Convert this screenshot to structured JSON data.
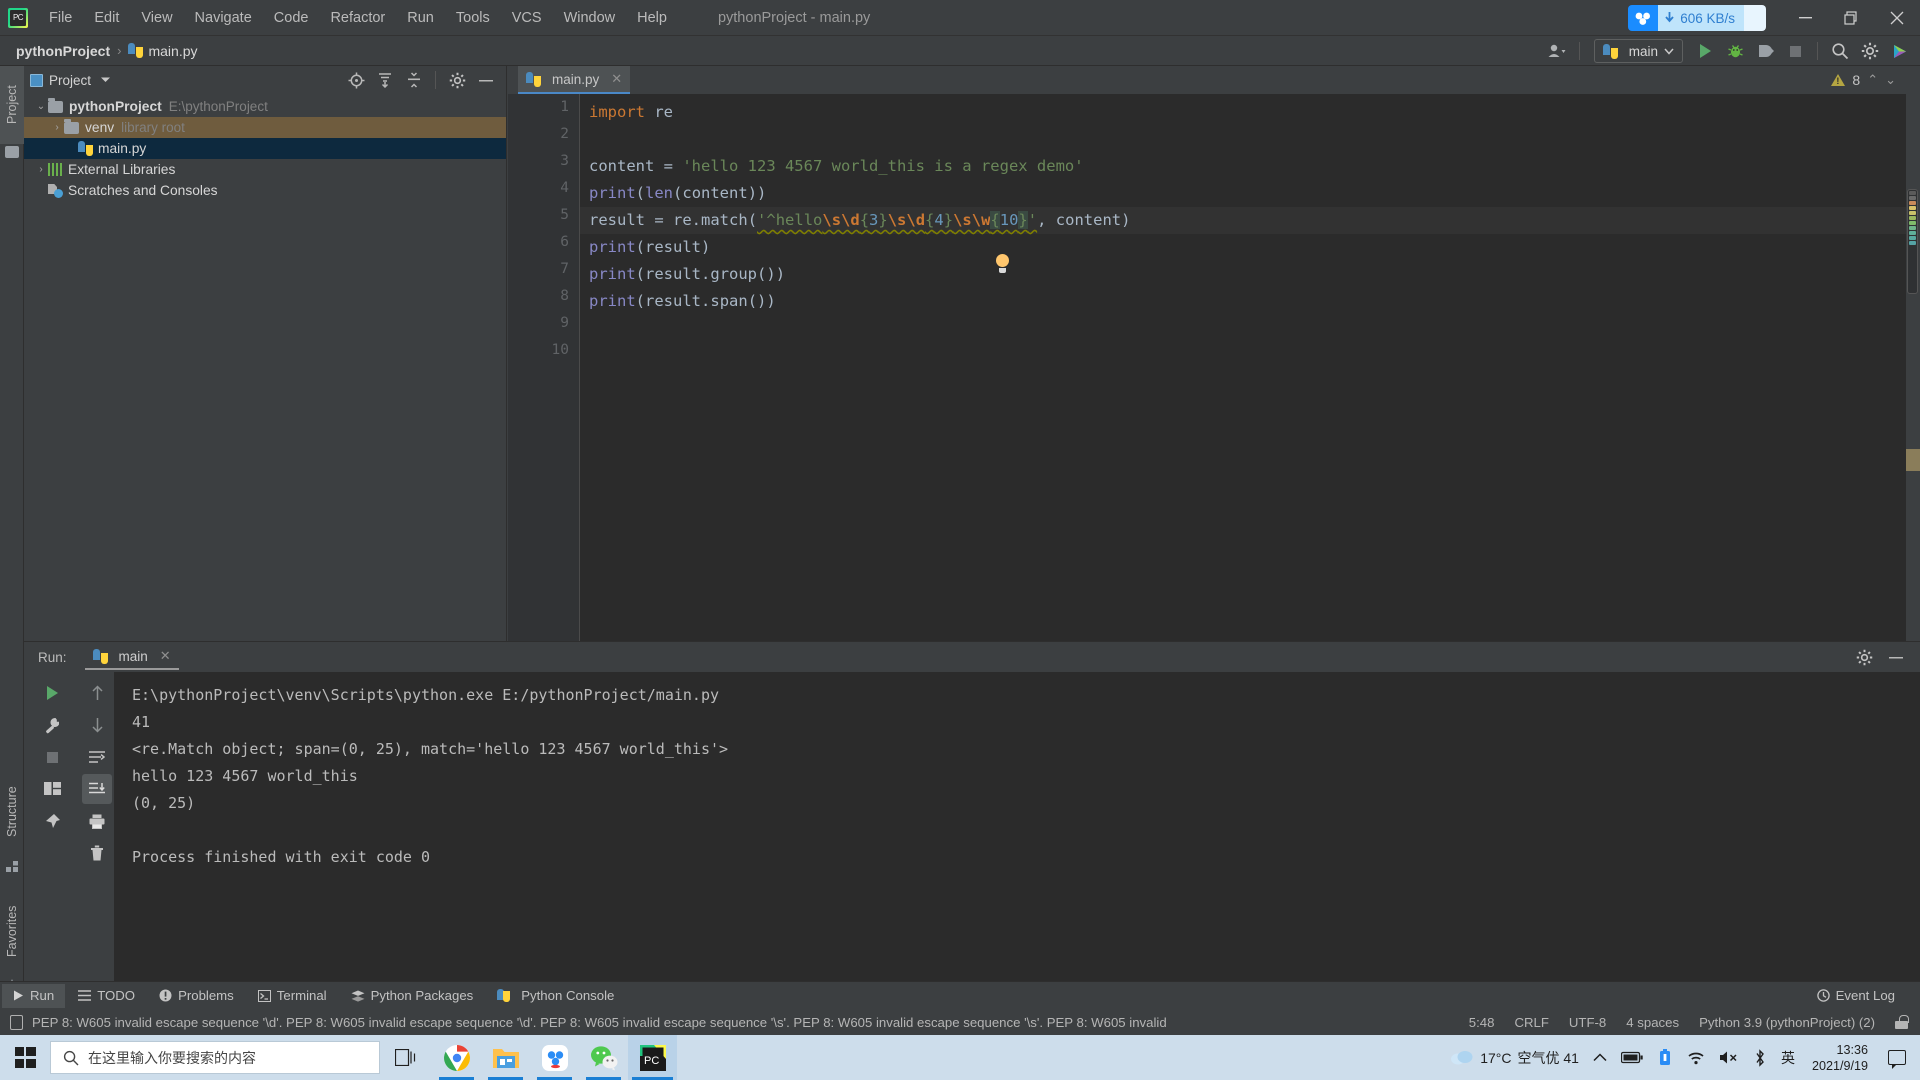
{
  "titlebar": {
    "app_icon": "pycharm-logo-icon",
    "window_title": "pythonProject - main.py",
    "net_speed": "606 KB/s",
    "net_icon": "baidu-netdisk-icon",
    "minimize": "—",
    "maximize": "❐",
    "close": "✕"
  },
  "menu": [
    {
      "label": "File"
    },
    {
      "label": "Edit"
    },
    {
      "label": "View"
    },
    {
      "label": "Navigate"
    },
    {
      "label": "Code"
    },
    {
      "label": "Refactor"
    },
    {
      "label": "Run"
    },
    {
      "label": "Tools"
    },
    {
      "label": "VCS"
    },
    {
      "label": "Window"
    },
    {
      "label": "Help"
    }
  ],
  "navbar": {
    "breadcrumb_project": "pythonProject",
    "breadcrumb_sep": "›",
    "breadcrumb_file": "main.py",
    "run_config": "main",
    "icons": {
      "user": "user-account-icon",
      "dropdown": "chevron-down-icon",
      "run": "run-icon",
      "debug": "debug-icon",
      "coverage": "run-with-coverage-icon",
      "stop": "stop-icon",
      "search": "search-everywhere-icon",
      "settings": "settings-gear-icon",
      "updates": "ide-updates-icon"
    }
  },
  "left_stripe": {
    "project": "Project",
    "structure": "Structure",
    "favorites": "Favorites"
  },
  "project_panel": {
    "title": "Project",
    "header_icons": [
      "locate-icon",
      "expand-all-icon",
      "collapse-all-icon",
      "settings-gear-icon",
      "hide-icon"
    ],
    "tree": [
      {
        "label": "pythonProject",
        "path": "E:\\pythonProject",
        "icon": "folder-icon",
        "arrow": "⌄",
        "state": "expanded",
        "bold": true
      },
      {
        "label": "venv",
        "path": "library root",
        "icon": "folder-icon",
        "arrow": "›",
        "state": "highlighted",
        "bold": false
      },
      {
        "label": "main.py",
        "path": "",
        "icon": "python-file-icon",
        "arrow": "",
        "state": "selected",
        "bold": false
      },
      {
        "label": "External Libraries",
        "path": "",
        "icon": "library-icon",
        "arrow": "›",
        "state": "normal",
        "bold": false
      },
      {
        "label": "Scratches and Consoles",
        "path": "",
        "icon": "scratches-icon",
        "arrow": "",
        "state": "normal",
        "bold": false
      }
    ]
  },
  "editor": {
    "tab_label": "main.py",
    "tab_icon": "python-file-icon",
    "tab_close": "✕",
    "warning_count": "8",
    "warning_icon": "warning-triangle-icon",
    "chevron_up": "⌃",
    "chevron_down": "⌄",
    "line_numbers": [
      "1",
      "2",
      "3",
      "4",
      "5",
      "6",
      "7",
      "8",
      "9",
      "10"
    ],
    "code_lines": [
      {
        "n": 1,
        "text": "import re"
      },
      {
        "n": 2,
        "text": ""
      },
      {
        "n": 3,
        "text": "content = 'hello 123 4567 world_this is a regex demo'"
      },
      {
        "n": 4,
        "text": "print(len(content))"
      },
      {
        "n": 5,
        "text": "result = re.match('^hello\\s\\d{3}\\s\\d{4}\\s\\w{10}', content)"
      },
      {
        "n": 6,
        "text": "print(result)"
      },
      {
        "n": 7,
        "text": "print(result.group())"
      },
      {
        "n": 8,
        "text": "print(result.span())"
      },
      {
        "n": 9,
        "text": ""
      },
      {
        "n": 10,
        "text": ""
      }
    ],
    "cursor_line": 5
  },
  "run_panel": {
    "label": "Run:",
    "tab_name": "main",
    "tab_icon": "python-file-icon",
    "tab_close": "✕",
    "toolbar_icons": [
      "rerun-icon",
      "wrench-icon",
      "stop-icon",
      "layout-icon",
      "pin-icon"
    ],
    "toolbar_icons2": [
      "up-arrow-icon",
      "down-arrow-icon",
      "soft-wrap-icon",
      "scroll-to-end-icon",
      "print-icon",
      "trash-icon"
    ],
    "settings_icon": "settings-gear-icon",
    "hide_icon": "hide-icon",
    "console_lines": [
      "E:\\pythonProject\\venv\\Scripts\\python.exe E:/pythonProject/main.py",
      "41",
      "<re.Match object; span=(0, 25), match='hello 123 4567 world_this'>",
      "hello 123 4567 world_this",
      "(0, 25)",
      "",
      "Process finished with exit code 0"
    ]
  },
  "toolwindow_bar": {
    "items": [
      {
        "label": "Run",
        "icon": "run-icon",
        "active": true
      },
      {
        "label": "TODO",
        "icon": "todo-icon",
        "active": false
      },
      {
        "label": "Problems",
        "icon": "problems-icon",
        "active": false
      },
      {
        "label": "Terminal",
        "icon": "terminal-icon",
        "active": false
      },
      {
        "label": "Python Packages",
        "icon": "packages-icon",
        "active": false
      },
      {
        "label": "Python Console",
        "icon": "python-console-icon",
        "active": false
      }
    ],
    "event_log": "Event Log",
    "event_log_icon": "event-log-icon"
  },
  "status_bar": {
    "message": "PEP 8: W605 invalid escape sequence '\\d'. PEP 8: W605 invalid escape sequence '\\d'. PEP 8: W605 invalid escape sequence '\\s'. PEP 8: W605 invalid escape sequence '\\s'. PEP 8: W605 invalid",
    "caret": "5:48",
    "line_separator": "CRLF",
    "encoding": "UTF-8",
    "indent": "4 spaces",
    "interpreter": "Python 3.9 (pythonProject) (2)",
    "lock_icon": "unlocked-icon"
  },
  "taskbar": {
    "start_icon": "windows-start-icon",
    "search_placeholder": "在这里输入你要搜索的内容",
    "search_icon": "search-icon",
    "task_view_icon": "task-view-icon",
    "apps": [
      {
        "name": "chrome-icon",
        "state": "running"
      },
      {
        "name": "file-explorer-icon",
        "state": "running"
      },
      {
        "name": "baidu-netdisk-icon",
        "state": "running"
      },
      {
        "name": "wechat-icon",
        "state": "running"
      },
      {
        "name": "pycharm-icon",
        "state": "active"
      }
    ],
    "weather_icon": "cloud-icon",
    "weather_temp": "17°C",
    "air_quality": "空气优 41",
    "tray_icons": [
      "show-hidden-icons-chevron",
      "battery-icon",
      "usb-icon",
      "wifi-icon",
      "volume-muted-icon",
      "bluetooth-icon"
    ],
    "ime": "英",
    "time": "13:36",
    "date": "2021/9/19",
    "notification_icon": "notification-icon"
  },
  "colors": {
    "ide_bg": "#3c3f41",
    "editor_bg": "#2b2b2b",
    "accent_blue": "#4a88c7",
    "run_green": "#59a869",
    "string_green": "#6a8759",
    "keyword_orange": "#cc7832",
    "number_blue": "#6897bb",
    "taskbar_bg": "#cdddeb",
    "selection_blue": "#0d293e",
    "warning_yellow": "#b5a642"
  }
}
